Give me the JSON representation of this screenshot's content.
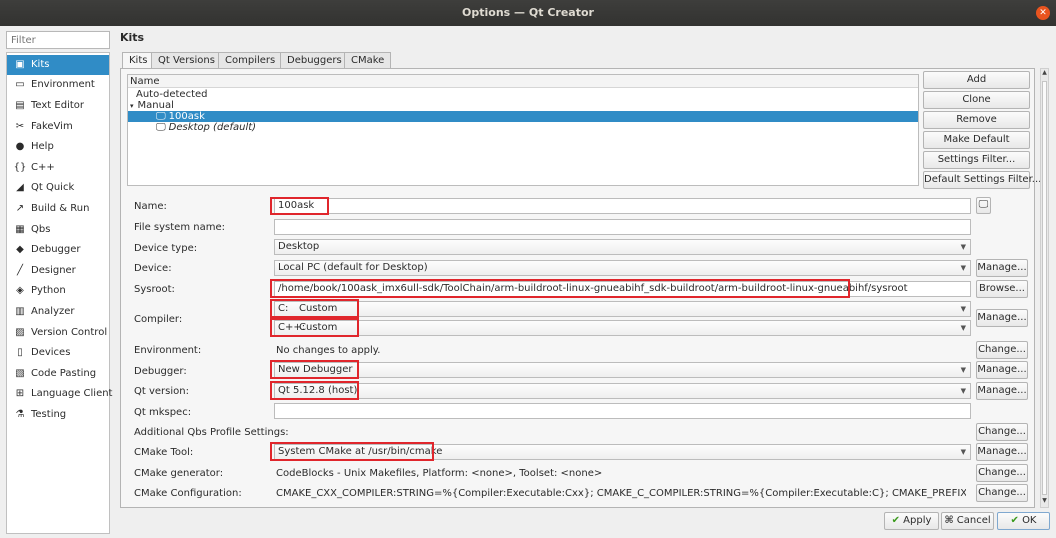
{
  "window": {
    "title": "Options — Qt Creator"
  },
  "filter": {
    "placeholder": "Filter"
  },
  "sidebar": {
    "items": [
      {
        "label": "Kits",
        "icon": "kits-icon"
      },
      {
        "label": "Environment",
        "icon": "monitor-icon"
      },
      {
        "label": "Text Editor",
        "icon": "text-editor-icon"
      },
      {
        "label": "FakeVim",
        "icon": "fakevim-icon"
      },
      {
        "label": "Help",
        "icon": "help-icon"
      },
      {
        "label": "C++",
        "icon": "braces-icon"
      },
      {
        "label": "Qt Quick",
        "icon": "qt-quick-icon"
      },
      {
        "label": "Build & Run",
        "icon": "build-run-icon"
      },
      {
        "label": "Qbs",
        "icon": "qbs-icon"
      },
      {
        "label": "Debugger",
        "icon": "debugger-icon"
      },
      {
        "label": "Designer",
        "icon": "designer-icon"
      },
      {
        "label": "Python",
        "icon": "python-icon"
      },
      {
        "label": "Analyzer",
        "icon": "analyzer-icon"
      },
      {
        "label": "Version Control",
        "icon": "version-control-icon"
      },
      {
        "label": "Devices",
        "icon": "devices-icon"
      },
      {
        "label": "Code Pasting",
        "icon": "code-pasting-icon"
      },
      {
        "label": "Language Client",
        "icon": "language-client-icon"
      },
      {
        "label": "Testing",
        "icon": "testing-icon"
      }
    ]
  },
  "main": {
    "title": "Kits",
    "tabs": [
      "Kits",
      "Qt Versions",
      "Compilers",
      "Debuggers",
      "CMake"
    ],
    "tree": {
      "header": "Name",
      "rows": [
        "Auto-detected",
        "Manual",
        "100ask",
        "Desktop (default)"
      ]
    },
    "buttons": {
      "add": "Add",
      "clone": "Clone",
      "remove": "Remove",
      "make_default": "Make Default",
      "settings_filter": "Settings Filter...",
      "default_settings_filter": "Default Settings Filter..."
    },
    "form": {
      "name": {
        "label": "Name:",
        "value": "100ask"
      },
      "fs_name": {
        "label": "File system name:",
        "value": ""
      },
      "device_type": {
        "label": "Device type:",
        "value": "Desktop"
      },
      "device": {
        "label": "Device:",
        "value": "Local PC (default for Desktop)"
      },
      "sysroot": {
        "label": "Sysroot:",
        "value": "/home/book/100ask_imx6ull-sdk/ToolChain/arm-buildroot-linux-gnueabihf_sdk-buildroot/arm-buildroot-linux-gnueabihf/sysroot"
      },
      "compiler": {
        "label": "Compiler:",
        "c_prefix": "C:",
        "c_value": "Custom",
        "cxx_prefix": "C++:",
        "cxx_value": "Custom"
      },
      "environment": {
        "label": "Environment:",
        "value": "No changes to apply."
      },
      "debugger": {
        "label": "Debugger:",
        "value": "New Debugger"
      },
      "qt_version": {
        "label": "Qt version:",
        "value": "Qt 5.12.8 (host)"
      },
      "qt_mkspec": {
        "label": "Qt mkspec:",
        "value": ""
      },
      "qbs_profile": {
        "label": "Additional Qbs Profile Settings:"
      },
      "cmake_tool": {
        "label": "CMake Tool:",
        "value": "System CMake at /usr/bin/cmake"
      },
      "cmake_generator": {
        "label": "CMake generator:",
        "value": "CodeBlocks - Unix Makefiles, Platform: <none>, Toolset: <none>"
      },
      "cmake_config": {
        "label": "CMake Configuration:",
        "value": "CMAKE_CXX_COMPILER:STRING=%{Compiler:Executable:Cxx}; CMAKE_C_COMPILER:STRING=%{Compiler:Executable:C}; CMAKE_PREFIX_PATH:STRING=%{..."
      }
    },
    "manage_label": "Manage...",
    "browse_label": "Browse...",
    "change_label": "Change..."
  },
  "footer": {
    "apply": "Apply",
    "cancel": "Cancel",
    "ok": "OK"
  },
  "colors": {
    "selection": "#308cc6",
    "highlight_box": "#e0262c"
  }
}
